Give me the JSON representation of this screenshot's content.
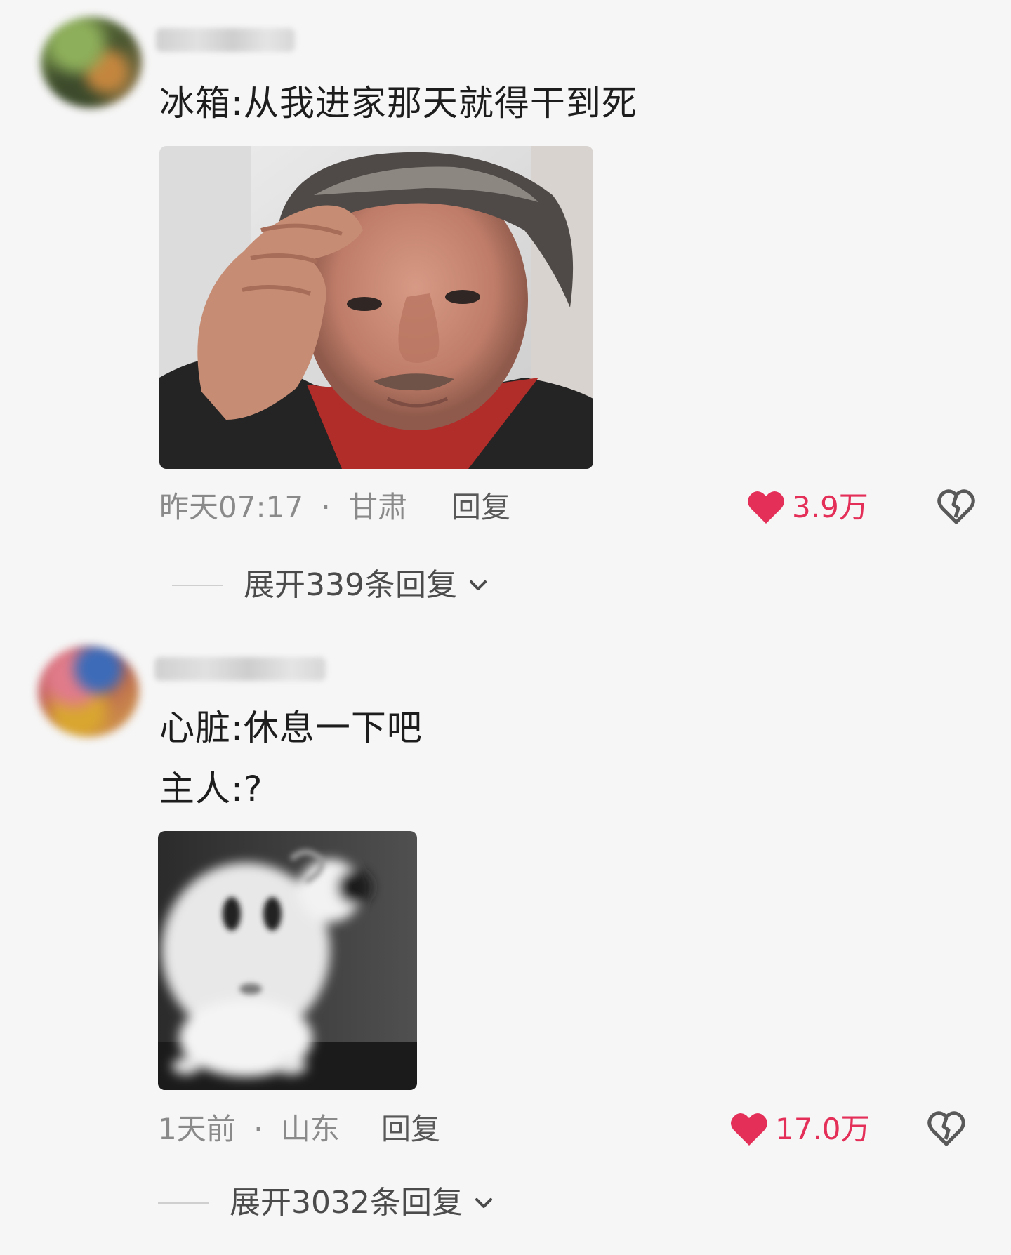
{
  "comments": [
    {
      "text_lines": [
        "冰箱:从我进家那天就得干到死"
      ],
      "time": "昨天07:17",
      "location": "甘肃",
      "reply_label": "回复",
      "likes": "3.9万",
      "expand_label": "展开339条回复"
    },
    {
      "text_lines": [
        "心脏:休息一下吧",
        "主人:?"
      ],
      "time": "1天前",
      "location": "山东",
      "reply_label": "回复",
      "likes": "17.0万",
      "expand_label": "展开3032条回复"
    }
  ],
  "meta_separator": "·",
  "icons": {
    "like": "heart-filled-icon",
    "dislike": "broken-heart-icon",
    "expand": "chevron-down-icon"
  },
  "colors": {
    "background": "#f6f6f6",
    "like": "#e42f59",
    "meta": "#8a8a8a"
  }
}
